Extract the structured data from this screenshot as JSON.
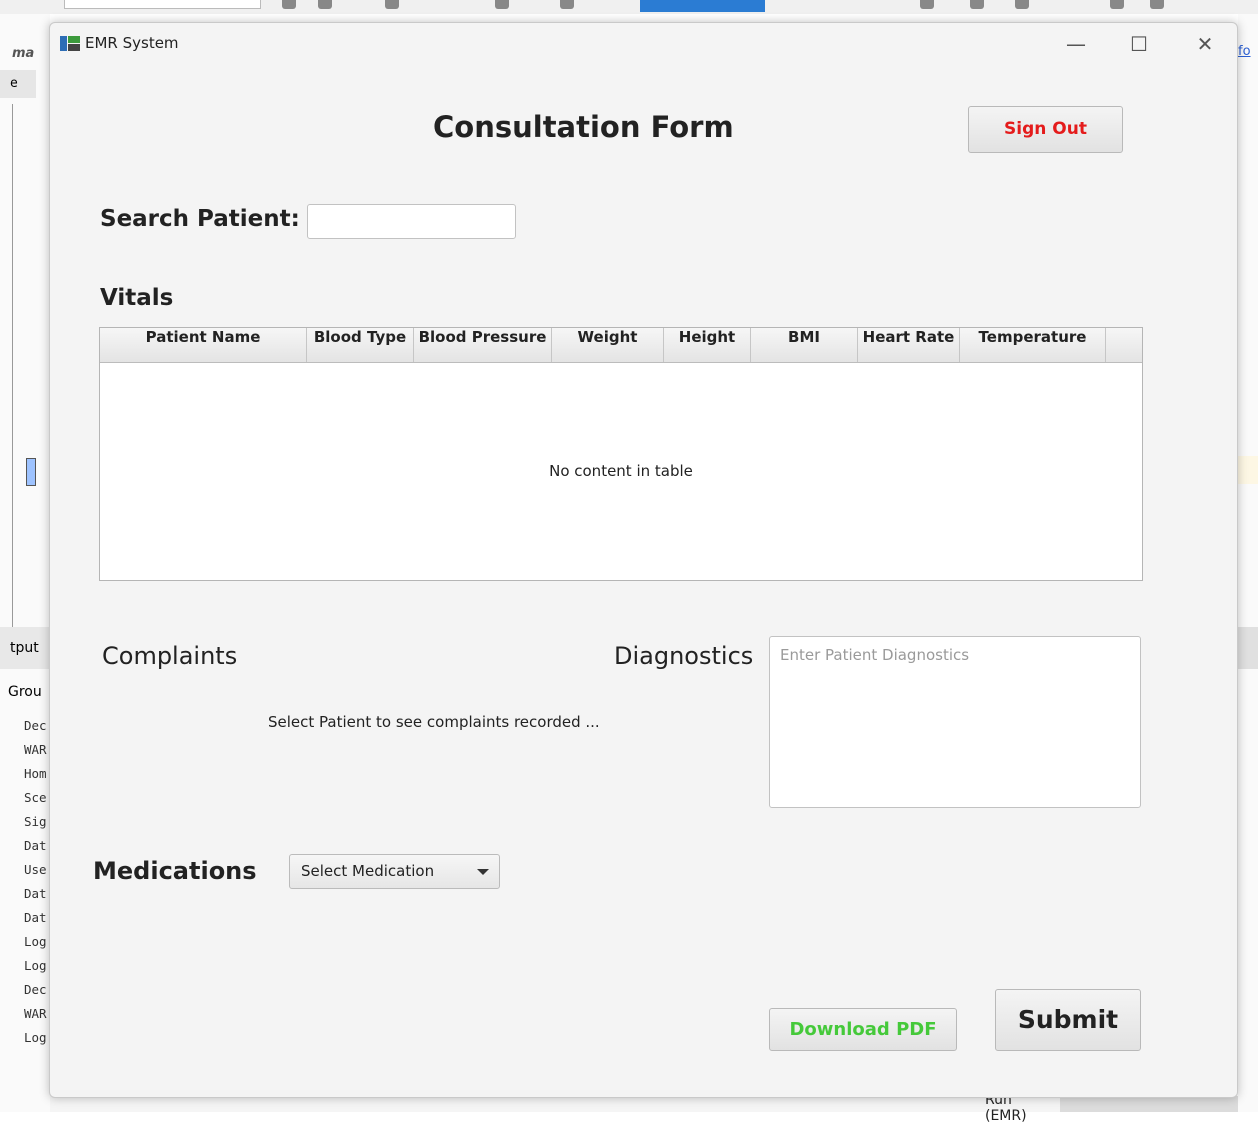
{
  "background": {
    "ide_logo": "ma",
    "tab_label": "e",
    "output_label": "tput",
    "group_label": "Grou",
    "log_lines": [
      "Dec",
      "WAR",
      "Hom",
      "Sce",
      "Sig",
      "Dat",
      "Use",
      "Dat",
      "Dat",
      "Log",
      "Log",
      "Dec",
      "WAR",
      "Log"
    ],
    "right_link": "fo",
    "run_label": "Run (EMR)"
  },
  "window": {
    "title": "EMR System",
    "minimize_glyph": "—",
    "maximize_glyph": "☐",
    "close_glyph": "✕"
  },
  "form": {
    "title": "Consultation Form",
    "sign_out_label": "Sign Out",
    "search_label": "Search Patient:",
    "search_value": "",
    "vitals_label": "Vitals",
    "table": {
      "columns": [
        "Patient Name",
        "Blood Type",
        "Blood Pressure",
        "Weight",
        "Height",
        "BMI",
        "Heart Rate",
        "Temperature"
      ],
      "empty_message": "No content in table"
    },
    "complaints_label": "Complaints",
    "complaints_message": "Select Patient to see complaints recorded ...",
    "diagnostics_label": "Diagnostics",
    "diagnostics_placeholder": "Enter Patient Diagnostics",
    "medications_label": "Medications",
    "medication_select": "Select Medication",
    "download_label": "Download PDF",
    "submit_label": "Submit"
  },
  "colors": {
    "sign_out": "#e41b1b",
    "download": "#45c93a",
    "window_bg": "#f4f4f4"
  }
}
